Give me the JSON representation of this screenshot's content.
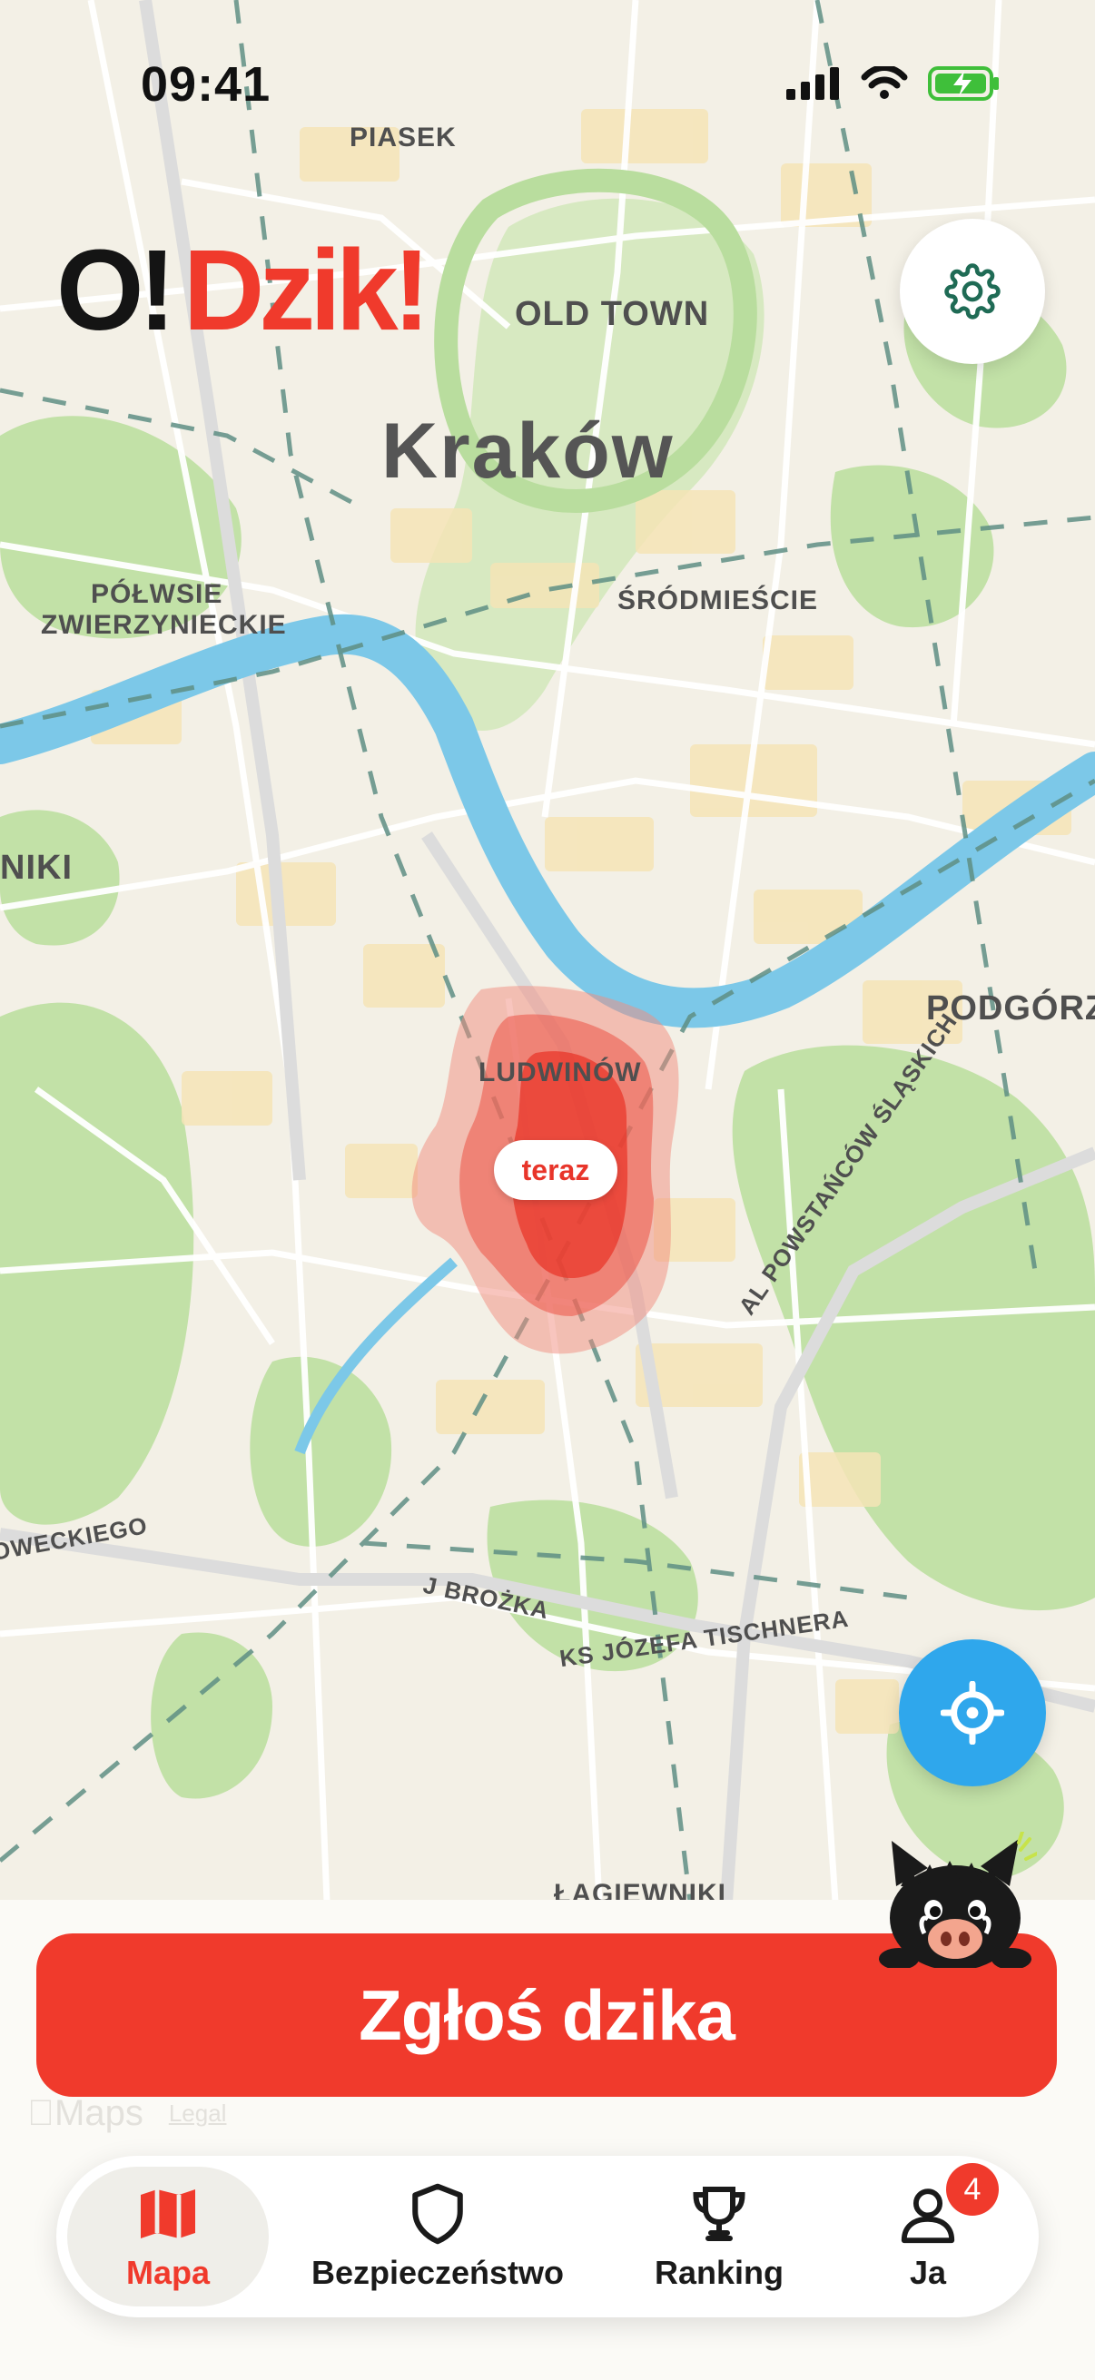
{
  "status_bar": {
    "time": "09:41"
  },
  "brand": {
    "logo_o": "O!",
    "logo_dzik": "Dzik!"
  },
  "map": {
    "labels": {
      "piasek": "PIASEK",
      "old_town": "OLD TOWN",
      "city": "Kraków",
      "polwsie_1": "PÓŁWSIE",
      "polwsie_2": "ZWIERZYNIECKIE",
      "srodmiescie": "ŚRÓDMIEŚCIE",
      "niki": "NIKI",
      "podgorze": "PODGÓRZ",
      "ludwinow": "LUDWINÓW",
      "al_powstancow": "AL POWSTAŃCÓW ŚLĄSKICH",
      "oweckiego": "OWECKIEGO",
      "brozka": "J BROŻKA",
      "tischnera": "KS JÓZEFA TISCHNERA",
      "lagiewniki": "ŁAGIEWNIKI"
    },
    "heat_label": "teraz",
    "attribution": {
      "brand": "Maps",
      "legal": "Legal"
    }
  },
  "report_button": {
    "label": "Zgłoś dzika"
  },
  "tab_bar": {
    "tabs": [
      {
        "label": "Mapa",
        "icon": "map-icon",
        "active": true
      },
      {
        "label": "Bezpieczeństwo",
        "icon": "shield-icon",
        "active": false
      },
      {
        "label": "Ranking",
        "icon": "trophy-icon",
        "active": false
      },
      {
        "label": "Ja",
        "icon": "person-icon",
        "active": false,
        "badge": "4"
      }
    ]
  },
  "colors": {
    "accent_red": "#f03a2c",
    "locate_blue": "#2fa7ec",
    "settings_green": "#1f6b55",
    "river": "#7cc8e8",
    "park": "#b9dd9e",
    "land": "#f3f0e6"
  }
}
